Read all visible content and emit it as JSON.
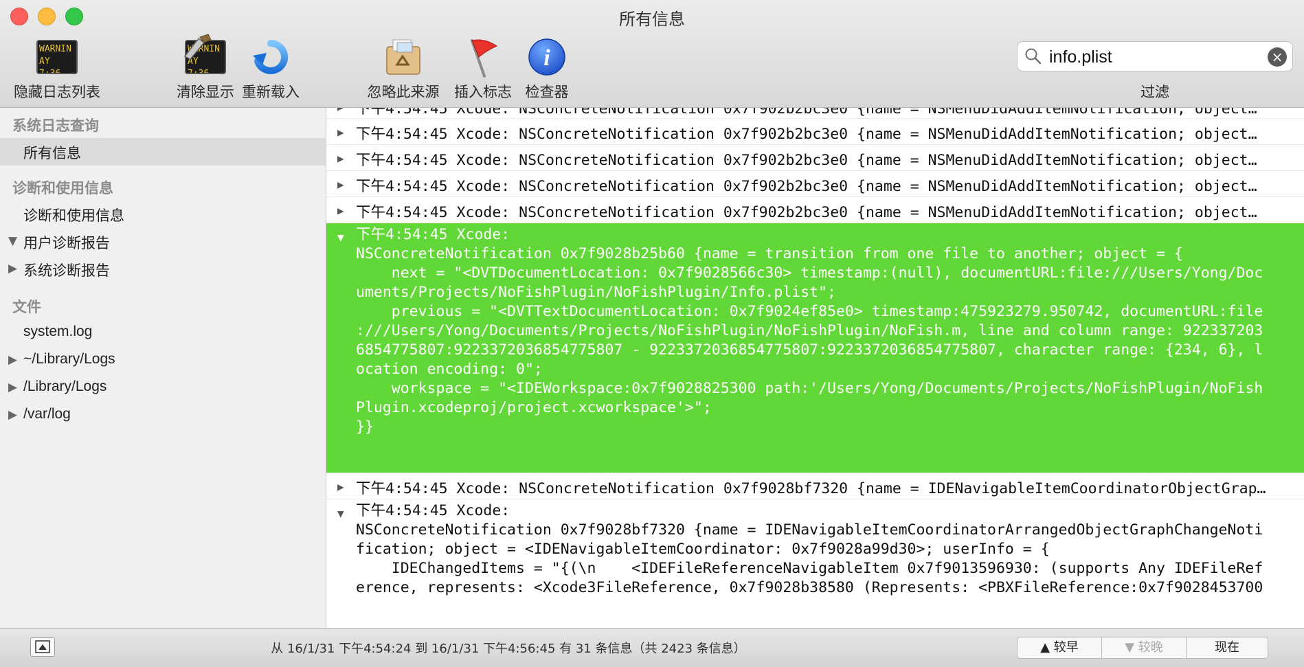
{
  "window": {
    "title": "所有信息"
  },
  "toolbar": {
    "hide_log_list": "隐藏日志列表",
    "clear_display": "清除显示",
    "reload": "重新载入",
    "ignore_sender": "忽略此来源",
    "insert_marker": "插入标志",
    "inspector": "检查器",
    "filter_label": "过滤",
    "search_value": "info.plist",
    "console_icon_text": [
      "WARNIN",
      "AY 7:36"
    ]
  },
  "sidebar": {
    "sec1_title": "系统日志查询",
    "all_messages": "所有信息",
    "sec2_title": "诊断和使用信息",
    "diag_item": "诊断和使用信息",
    "user_reports": "用户诊断报告",
    "system_reports": "系统诊断报告",
    "sec3_title": "文件",
    "file_system_log": "system.log",
    "file_user_library": "~/Library/Logs",
    "file_library": "/Library/Logs",
    "file_var_log": "/var/log"
  },
  "log": {
    "partial_top": "下午4:54:45 Xcode: NSConcreteNotification 0x7f902b2bc3e0 {name = NSMenuDidAddItemNotification; object…",
    "collapsed_rows": [
      "下午4:54:45 Xcode: NSConcreteNotification 0x7f902b2bc3e0 {name = NSMenuDidAddItemNotification; object…",
      "下午4:54:45 Xcode: NSConcreteNotification 0x7f902b2bc3e0 {name = NSMenuDidAddItemNotification; object…",
      "下午4:54:45 Xcode: NSConcreteNotification 0x7f902b2bc3e0 {name = NSMenuDidAddItemNotification; object…",
      "下午4:54:45 Xcode: NSConcreteNotification 0x7f902b2bc3e0 {name = NSMenuDidAddItemNotification; object…"
    ],
    "selected_header": "下午4:54:45 Xcode:",
    "selected_lines": [
      "NSConcreteNotification 0x7f9028b25b60 {name = transition from one file to another; object = {",
      "    next = \"<DVTDocumentLocation: 0x7f9028566c30> timestamp:(null), documentURL:file:///Users/Yong/Doc",
      "uments/Projects/NoFishPlugin/NoFishPlugin/Info.plist\";",
      "    previous = \"<DVTTextDocumentLocation: 0x7f9024ef85e0> timestamp:475923279.950742, documentURL:file",
      ":///Users/Yong/Documents/Projects/NoFishPlugin/NoFishPlugin/NoFish.m, line and column range: 922337203",
      "6854775807:9223372036854775807 - 9223372036854775807:9223372036854775807, character range: {234, 6}, l",
      "ocation encoding: 0\";",
      "    workspace = \"<IDEWorkspace:0x7f9028825300 path:'/Users/Yong/Documents/Projects/NoFishPlugin/NoFish",
      "Plugin.xcodeproj/project.xcworkspace'>\";",
      "}}"
    ],
    "row_after": "下午4:54:45 Xcode: NSConcreteNotification 0x7f9028bf7320 {name = IDENavigableItemCoordinatorObjectGrap…",
    "expanded_header": "下午4:54:45 Xcode:",
    "expanded_lines": [
      "NSConcreteNotification 0x7f9028bf7320 {name = IDENavigableItemCoordinatorArrangedObjectGraphChangeNoti",
      "fication; object = <IDENavigableItemCoordinator: 0x7f9028a99d30>; userInfo = {",
      "    IDEChangedItems = \"{(\\n    <IDEFileReferenceNavigableItem 0x7f9013596930: (supports Any IDEFileRef",
      "erence, represents: <Xcode3FileReference, 0x7f9028b38580 (Represents: <PBXFileReference:0x7f9028453700"
    ]
  },
  "status": {
    "summary": "从 16/1/31 下午4:54:24 到 16/1/31 下午4:56:45 有 31 条信息（共 2423 条信息）",
    "earlier": "较早",
    "later": "较晚",
    "now": "现在"
  },
  "colors": {
    "selection_green": "#61d837",
    "sidebar_bg": "#f0f0f0"
  }
}
